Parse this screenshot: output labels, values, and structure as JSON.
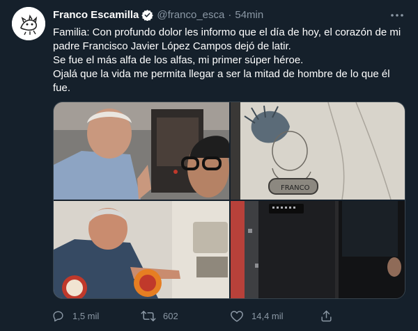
{
  "tweet": {
    "author_name": "Franco Escamilla",
    "handle": "@franco_esca",
    "separator": "·",
    "time": "54min",
    "text_lines": [
      "Familia: Con profundo dolor les informo que el día de hoy, el corazón de mi padre Francisco Javier López Campos dejó de latir.",
      "Se fue el más alfa de los alfas, mi primer súper héroe.",
      "Ojalá que la vida me permita llegar a ser la mitad de hombre de lo que él fue."
    ],
    "photo_text": "FRANCO",
    "stats": {
      "replies": "1,5 mil",
      "retweets": "602",
      "likes": "14,4 mil"
    }
  },
  "colors": {
    "background": "#15202b",
    "text": "#ffffff",
    "secondary": "#8b98a5",
    "verified": "#ffffff",
    "border": "#38444d"
  },
  "icons": {
    "verified": "verified-badge-icon",
    "more": "more-icon",
    "reply": "reply-icon",
    "retweet": "retweet-icon",
    "like": "heart-icon",
    "share": "share-icon"
  }
}
